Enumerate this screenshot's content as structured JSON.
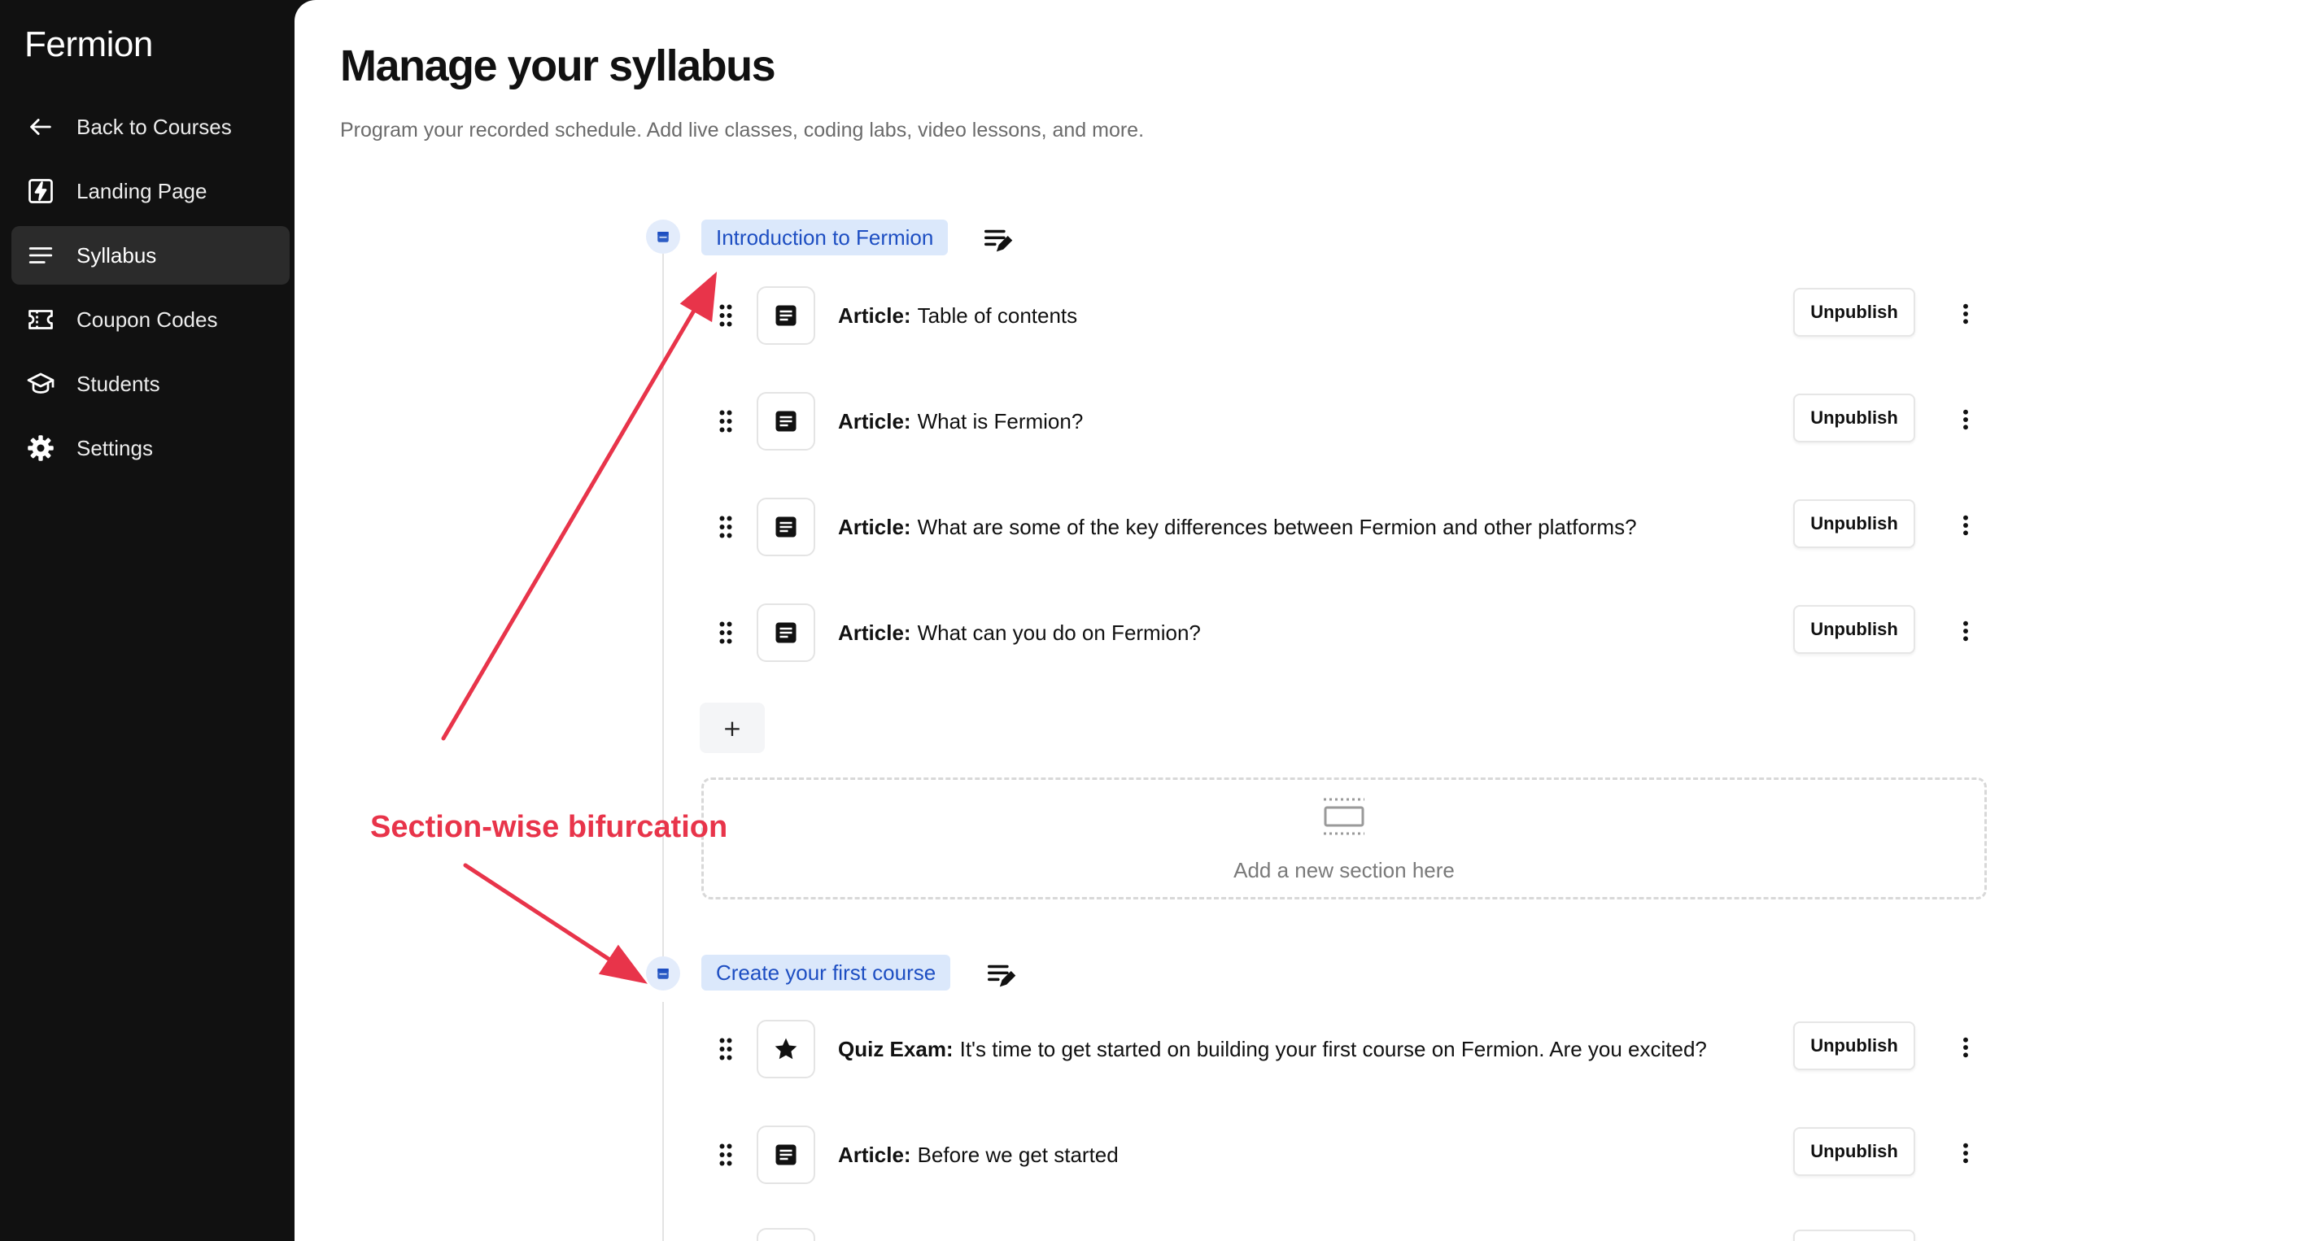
{
  "app": {
    "name": "Fermion"
  },
  "sidebar": {
    "items": [
      {
        "label": "Back to Courses",
        "icon": "arrow-left-icon"
      },
      {
        "label": "Landing Page",
        "icon": "bolt-icon"
      },
      {
        "label": "Syllabus",
        "icon": "list-lines-icon",
        "active": true
      },
      {
        "label": "Coupon Codes",
        "icon": "ticket-icon"
      },
      {
        "label": "Students",
        "icon": "graduation-cap-icon"
      },
      {
        "label": "Settings",
        "icon": "gear-icon"
      }
    ]
  },
  "page": {
    "title": "Manage your syllabus",
    "subtitle": "Program your recorded schedule. Add live classes, coding labs, video lessons, and more."
  },
  "sections": [
    {
      "title": "Introduction to Fermion",
      "lessons": [
        {
          "type": "Article:",
          "title": "Table of contents",
          "icon": "document-icon",
          "action": "Unpublish"
        },
        {
          "type": "Article:",
          "title": "What is Fermion?",
          "icon": "document-icon",
          "action": "Unpublish"
        },
        {
          "type": "Article:",
          "title": "What are some of the key differences between Fermion and other platforms?",
          "icon": "document-icon",
          "action": "Unpublish"
        },
        {
          "type": "Article:",
          "title": "What can you do on Fermion?",
          "icon": "document-icon",
          "action": "Unpublish"
        }
      ],
      "add_lesson_label": "+"
    },
    {
      "title": "Create your first course",
      "lessons": [
        {
          "type": "Quiz Exam:",
          "title": "It's time to get started on building your first course on Fermion. Are you excited?",
          "icon": "star-icon",
          "action": "Unpublish"
        },
        {
          "type": "Article:",
          "title": "Before we get started",
          "icon": "document-icon",
          "action": "Unpublish"
        }
      ]
    }
  ],
  "add_section": {
    "label": "Add a new section here",
    "icon": "section-placeholder-icon"
  },
  "annotation": {
    "text": "Section-wise bifurcation",
    "color": "#e8344a"
  },
  "colors": {
    "sidebar_bg": "#111111",
    "chip_bg": "#dbe8fb",
    "chip_text": "#1d4ec2",
    "annotation": "#e8344a"
  }
}
